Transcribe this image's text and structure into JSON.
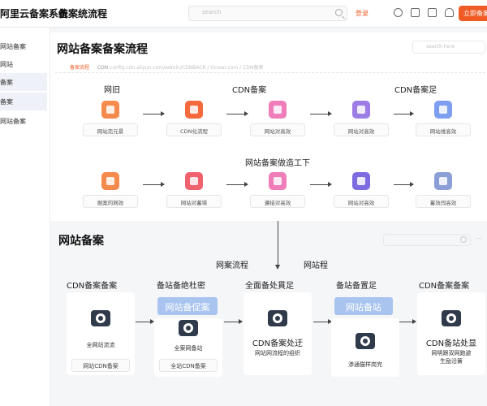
{
  "header": {
    "brand": "阿里云备案系统",
    "title": "备案统流程",
    "search_placeholder": "search",
    "login": "登录",
    "cta": "立即备案"
  },
  "sidebar": {
    "items": [
      "网站备案",
      "网站",
      "备案",
      "备案",
      "网站备案"
    ]
  },
  "section1": {
    "title": "网站备案备案流程",
    "search_placeholder": "search here",
    "info_tag": "备案流程",
    "info_cdn": "CDN",
    "info_text": "config.cdn.aliyun.com/admin/CDNBACK / Ocean.com / CDN备案",
    "row1_labels": [
      "网旧",
      "CDN备案",
      "CDN备案足"
    ],
    "row1_nodes": [
      "网站完元景",
      "CDN化流程",
      "网站对高效",
      "网站对高效",
      "网站维高效"
    ],
    "row2_label": "网站备案做造工下",
    "row2_nodes": [
      "据案的网效",
      "网站对蓄堪",
      "遵接对高效",
      "网站对高效",
      "蓄效闯高效"
    ]
  },
  "section2": {
    "title": "网站备案",
    "flow_label_1": "网案流程",
    "flow_label_2": "网站程",
    "columns": [
      {
        "heading": "CDN备案备案",
        "text": "全网站流流",
        "pill": "网站CDN备案"
      },
      {
        "heading": "备站备绝杜密",
        "banner": "网站备促案",
        "text": "全案网备站",
        "pill": "全站CDN备案"
      },
      {
        "heading": "全面备处貫足",
        "big": "CDN备案处迂",
        "text": "网站网流程的组织"
      },
      {
        "heading": "备站备置足",
        "banner": "网站备站",
        "text": "渗通猫样岗完"
      },
      {
        "heading": "CDN备案备案",
        "big": "CDN备站处显",
        "text": "网明跟双网跑避",
        "text2": "生励沿簧"
      }
    ]
  },
  "colors": {
    "accent": "#f05a24",
    "banner": "#a9c4ef"
  }
}
